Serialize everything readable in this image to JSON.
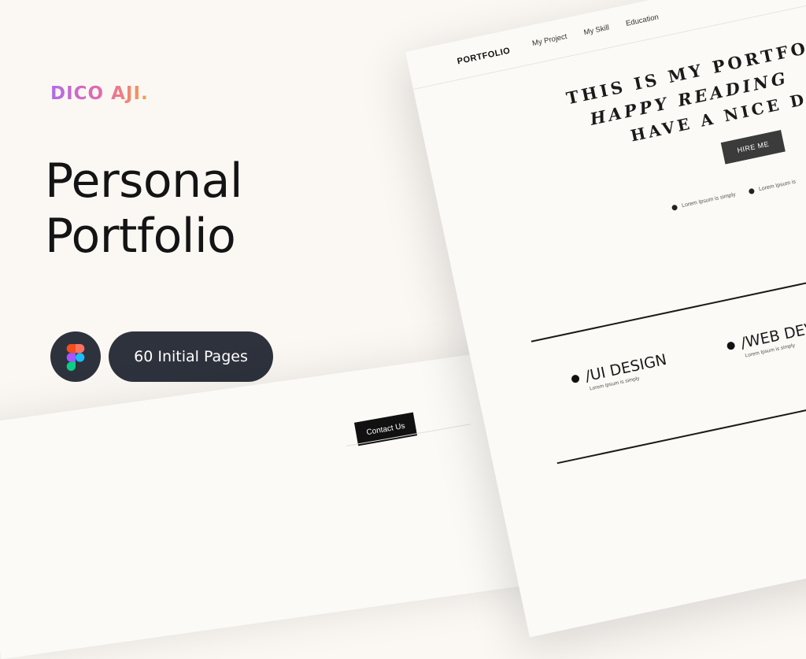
{
  "brand": "DICO AJI.",
  "hero": {
    "line1": "Personal",
    "line2": "Portfolio"
  },
  "pages_pill": "60 Initial Pages",
  "back_sheet": {
    "contact_label": "Contact Us"
  },
  "mockup": {
    "logo": "PORTFOLIO",
    "nav": [
      "My Project",
      "My Skill",
      "Education"
    ],
    "headline": [
      "THIS IS MY PORTFO",
      "HAPPY READING",
      "HAVE A NICE D"
    ],
    "hire_label": "HIRE ME",
    "bullets": [
      "Lorem Ipsum is simply",
      "Lorem Ipsum is"
    ],
    "services": [
      {
        "title": "/UI DESIGN",
        "sub": "Lorem Ipsum is simply"
      },
      {
        "title": "/WEB DEV",
        "sub": "Lorem Ipsum is simply"
      }
    ]
  },
  "colors": {
    "background": "#fbf8f4",
    "dark_pill": "#2e323c",
    "brand_gradient": [
      "#b06ce8",
      "#e86aa6",
      "#f7a046"
    ]
  },
  "icons": {
    "figma": "figma-icon"
  }
}
